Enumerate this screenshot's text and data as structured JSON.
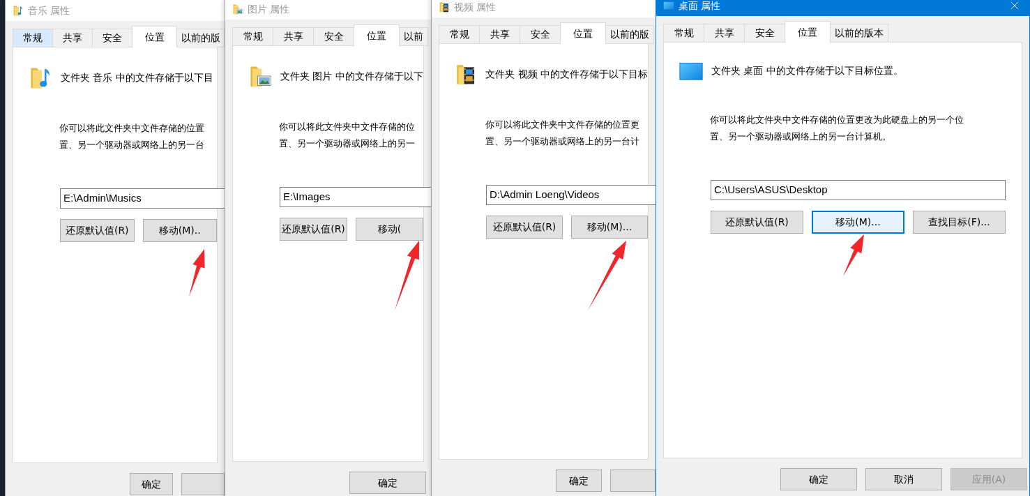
{
  "windows": [
    {
      "kind": "music",
      "title": "音乐 属性",
      "active": false,
      "tabs": [
        {
          "label": "常规",
          "selected": false,
          "hovered": true
        },
        {
          "label": "共享",
          "selected": false,
          "hovered": false
        },
        {
          "label": "安全",
          "selected": false,
          "hovered": false
        },
        {
          "label": "位置",
          "selected": true,
          "hovered": false
        },
        {
          "label": "以前的版",
          "selected": false,
          "hovered": false
        }
      ],
      "heading": "文件夹 音乐 中的文件存储于以下目",
      "description_lines": [
        "你可以将此文件夹中文件存储的位置",
        "置、另一个驱动器或网络上的另一台"
      ],
      "path": "E:\\Admin\\Musics",
      "buttons": [
        {
          "label": "还原默认值(R)",
          "focused": false
        },
        {
          "label": "移动(M)..",
          "focused": false
        }
      ],
      "bottom_buttons": [
        {
          "label": "确定",
          "disabled": false
        },
        {
          "disabled": false
        }
      ],
      "pointer_arrow": true
    },
    {
      "kind": "pictures",
      "title": "图片 属性",
      "active": false,
      "tabs": [
        {
          "label": "常规",
          "selected": false,
          "hovered": false
        },
        {
          "label": "共享",
          "selected": false,
          "hovered": false
        },
        {
          "label": "安全",
          "selected": false,
          "hovered": false
        },
        {
          "label": "位置",
          "selected": true,
          "hovered": false
        },
        {
          "label": "以前",
          "selected": false,
          "hovered": false
        }
      ],
      "heading": "文件夹 图片 中的文件存储于以下",
      "description_lines": [
        "你可以将此文件夹中文件存储的位",
        "置、另一个驱动器或网络上的另一"
      ],
      "path": "E:\\Images",
      "buttons": [
        {
          "label": "还原默认值(R)",
          "focused": false
        },
        {
          "label": "移动(",
          "focused": false
        }
      ],
      "bottom_buttons": [
        {
          "label": "确定",
          "disabled": false
        }
      ],
      "pointer_arrow": true
    },
    {
      "kind": "videos",
      "title": "视频 属性",
      "active": false,
      "tabs": [
        {
          "label": "常规",
          "selected": false,
          "hovered": false
        },
        {
          "label": "共享",
          "selected": false,
          "hovered": false
        },
        {
          "label": "安全",
          "selected": false,
          "hovered": false
        },
        {
          "label": "位置",
          "selected": true,
          "hovered": false
        },
        {
          "label": "以前的版",
          "selected": false,
          "hovered": false
        }
      ],
      "heading": "文件夹 视频 中的文件存储于以下目标",
      "description_lines": [
        "你可以将此文件夹中文件存储的位置更",
        "置、另一个驱动器或网络上的另一台计"
      ],
      "path": "D:\\Admin Loeng\\Videos",
      "buttons": [
        {
          "label": "还原默认值(R)",
          "focused": false
        },
        {
          "label": "移动(M)...",
          "focused": false
        }
      ],
      "bottom_buttons": [
        {
          "label": "确定",
          "disabled": false
        },
        {
          "disabled": false
        }
      ],
      "pointer_arrow": true
    },
    {
      "kind": "desktop",
      "title": "桌面 属性",
      "active": true,
      "tabs": [
        {
          "label": "常规",
          "selected": false,
          "hovered": false
        },
        {
          "label": "共享",
          "selected": false,
          "hovered": false
        },
        {
          "label": "安全",
          "selected": false,
          "hovered": false
        },
        {
          "label": "位置",
          "selected": true,
          "hovered": false
        },
        {
          "label": "以前的版本",
          "selected": false,
          "hovered": false
        }
      ],
      "heading": "文件夹 桌面 中的文件存储于以下目标位置。",
      "description_lines": [
        "你可以将此文件夹中文件存储的位置更改为此硬盘上的另一个位",
        "置、另一个驱动器或网络上的另一台计算机。"
      ],
      "path": "C:\\Users\\ASUS\\Desktop",
      "buttons": [
        {
          "label": "还原默认值(R)",
          "focused": false
        },
        {
          "label": "移动(M)...",
          "focused": true
        },
        {
          "label": "查找目标(F)...",
          "focused": false
        }
      ],
      "bottom_buttons": [
        {
          "label": "确定",
          "disabled": false
        },
        {
          "label": "取消",
          "disabled": false
        },
        {
          "label": "应用(A)",
          "disabled": true
        }
      ],
      "pointer_arrow": true
    }
  ]
}
